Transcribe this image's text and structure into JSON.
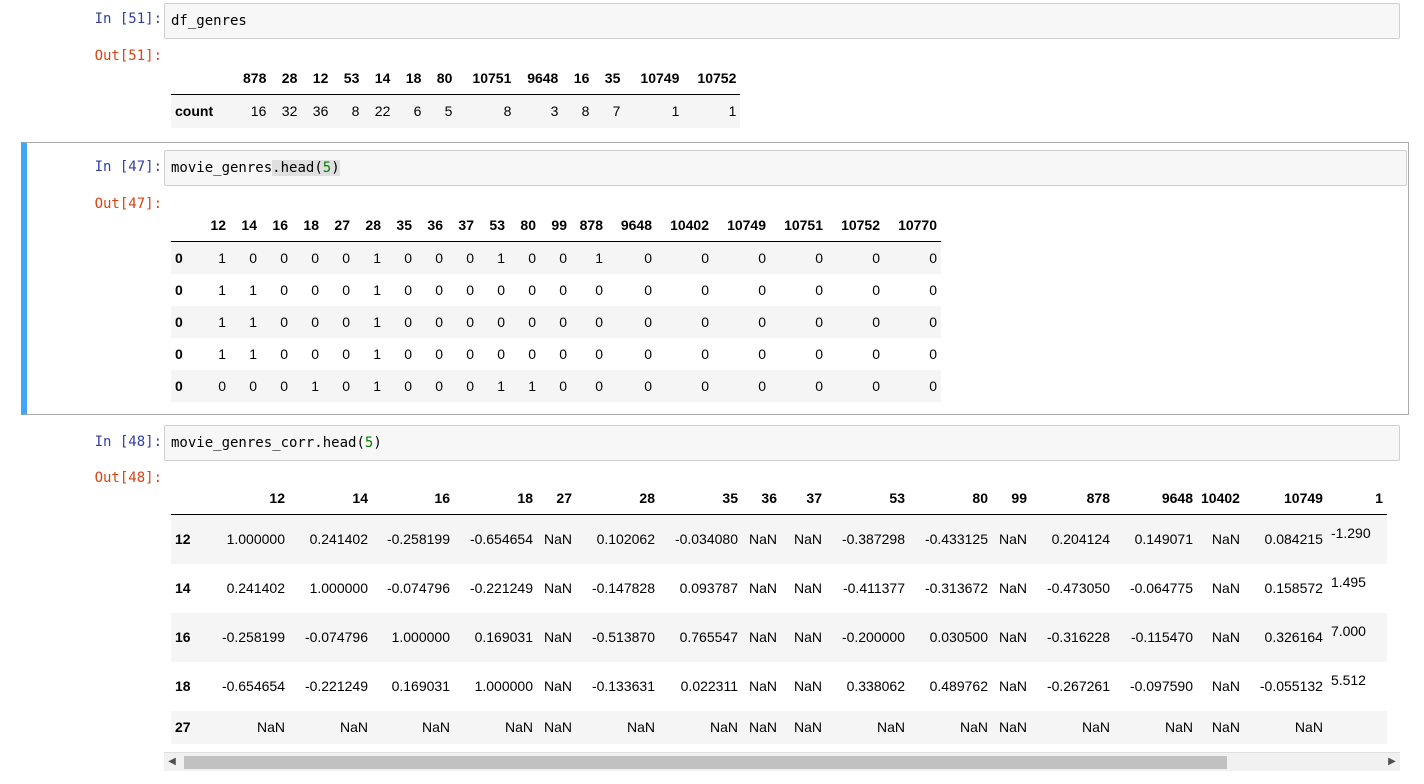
{
  "cells": [
    {
      "in_prompt": "In [51]:",
      "code": "df_genres",
      "out_prompt": "Out[51]:",
      "table": {
        "columns": [
          "878",
          "28",
          "12",
          "53",
          "14",
          "18",
          "80",
          "10751",
          "9648",
          "16",
          "35",
          "10749",
          "10752"
        ],
        "rows": [
          {
            "index": "count",
            "values": [
              "16",
              "32",
              "36",
              "8",
              "22",
              "6",
              "5",
              "8",
              "3",
              "8",
              "7",
              "1",
              "1"
            ]
          }
        ]
      }
    },
    {
      "in_prompt": "In [47]:",
      "code_prefix": "movie_genres",
      "code_hl": ".head",
      "code_open": "(",
      "code_arg": "5",
      "code_close": ")",
      "out_prompt": "Out[47]:",
      "table": {
        "columns": [
          "12",
          "14",
          "16",
          "18",
          "27",
          "28",
          "35",
          "36",
          "37",
          "53",
          "80",
          "99",
          "878",
          "9648",
          "10402",
          "10749",
          "10751",
          "10752",
          "10770"
        ],
        "rows": [
          {
            "index": "0",
            "values": [
              "1",
              "0",
              "0",
              "0",
              "0",
              "1",
              "0",
              "0",
              "0",
              "1",
              "0",
              "0",
              "1",
              "0",
              "0",
              "0",
              "0",
              "0",
              "0"
            ]
          },
          {
            "index": "0",
            "values": [
              "1",
              "1",
              "0",
              "0",
              "0",
              "1",
              "0",
              "0",
              "0",
              "0",
              "0",
              "0",
              "0",
              "0",
              "0",
              "0",
              "0",
              "0",
              "0"
            ]
          },
          {
            "index": "0",
            "values": [
              "1",
              "1",
              "0",
              "0",
              "0",
              "1",
              "0",
              "0",
              "0",
              "0",
              "0",
              "0",
              "0",
              "0",
              "0",
              "0",
              "0",
              "0",
              "0"
            ]
          },
          {
            "index": "0",
            "values": [
              "1",
              "1",
              "0",
              "0",
              "0",
              "1",
              "0",
              "0",
              "0",
              "0",
              "0",
              "0",
              "0",
              "0",
              "0",
              "0",
              "0",
              "0",
              "0"
            ]
          },
          {
            "index": "0",
            "values": [
              "0",
              "0",
              "0",
              "1",
              "0",
              "1",
              "0",
              "0",
              "0",
              "1",
              "1",
              "0",
              "0",
              "0",
              "0",
              "0",
              "0",
              "0",
              "0"
            ]
          }
        ]
      }
    },
    {
      "in_prompt": "In [48]:",
      "code_prefix": "movie_genres_corr.head",
      "code_open": "(",
      "code_arg": "5",
      "code_close": ")",
      "out_prompt": "Out[48]:",
      "table": {
        "columns": [
          "12",
          "14",
          "16",
          "18",
          "27",
          "28",
          "35",
          "36",
          "37",
          "53",
          "80",
          "99",
          "878",
          "9648",
          "10402",
          "10749",
          "1"
        ],
        "rows": [
          {
            "index": "12",
            "values": [
              "1.000000",
              "0.241402",
              "-0.258199",
              "-0.654654",
              "NaN",
              "0.102062",
              "-0.034080",
              "NaN",
              "NaN",
              "-0.387298",
              "-0.433125",
              "NaN",
              "0.204124",
              "0.149071",
              "NaN",
              "0.084215",
              "-1.290"
            ]
          },
          {
            "index": "14",
            "values": [
              "0.241402",
              "1.000000",
              "-0.074796",
              "-0.221249",
              "NaN",
              "-0.147828",
              "0.093787",
              "NaN",
              "NaN",
              "-0.411377",
              "-0.313672",
              "NaN",
              "-0.473050",
              "-0.064775",
              "NaN",
              "0.158572",
              "1.495"
            ]
          },
          {
            "index": "16",
            "values": [
              "-0.258199",
              "-0.074796",
              "1.000000",
              "0.169031",
              "NaN",
              "-0.513870",
              "0.765547",
              "NaN",
              "NaN",
              "-0.200000",
              "0.030500",
              "NaN",
              "-0.316228",
              "-0.115470",
              "NaN",
              "0.326164",
              "7.000"
            ]
          },
          {
            "index": "18",
            "values": [
              "-0.654654",
              "-0.221249",
              "0.169031",
              "1.000000",
              "NaN",
              "-0.133631",
              "0.022311",
              "NaN",
              "NaN",
              "0.338062",
              "0.489762",
              "NaN",
              "-0.267261",
              "-0.097590",
              "NaN",
              "-0.055132",
              "5.512"
            ]
          },
          {
            "index": "27",
            "values": [
              "NaN",
              "NaN",
              "NaN",
              "NaN",
              "NaN",
              "NaN",
              "NaN",
              "NaN",
              "NaN",
              "NaN",
              "NaN",
              "NaN",
              "NaN",
              "NaN",
              "NaN",
              "NaN",
              ""
            ]
          }
        ]
      }
    }
  ],
  "scrollbar": {
    "left_arrow": "◀",
    "right_arrow": "▶"
  }
}
